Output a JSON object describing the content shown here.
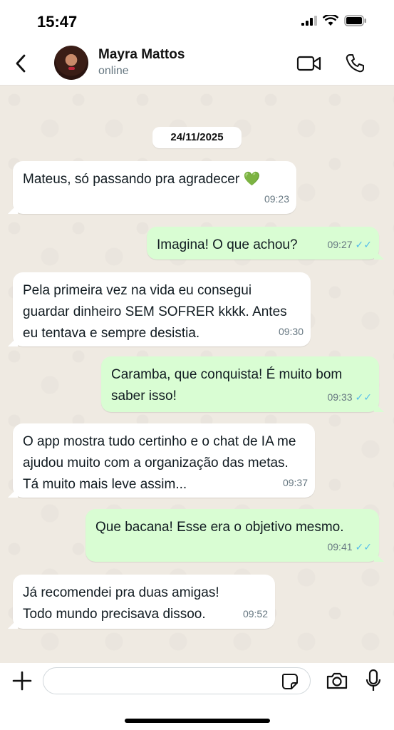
{
  "status_bar": {
    "time": "15:47"
  },
  "header": {
    "name": "Mayra Mattos",
    "status": "online"
  },
  "chat": {
    "date": "24/11/2025",
    "messages": [
      {
        "dir": "in",
        "text": "Mateus, só passando pra agradecer 💚",
        "time": "09:23"
      },
      {
        "dir": "out",
        "text": "Imagina! O que achou?",
        "time": "09:27",
        "ticks": "✓✓"
      },
      {
        "dir": "in",
        "text": "Pela primeira vez na vida eu consegui guardar dinheiro SEM SOFRER kkkk. Antes eu tentava e sempre desistia.",
        "time": "09:30"
      },
      {
        "dir": "out",
        "text": "Caramba, que conquista! É muito bom saber isso!",
        "time": "09:33",
        "ticks": "✓✓"
      },
      {
        "dir": "in",
        "text": "O app mostra tudo certinho e o chat de IA me ajudou muito com a organização das metas. Tá muito mais leve assim...",
        "time": "09:37"
      },
      {
        "dir": "out",
        "text": "Que bacana! Esse era o objetivo mesmo.",
        "time": "09:41",
        "ticks": "✓✓"
      },
      {
        "dir": "in",
        "text": "Já recomendei pra duas amigas! Todo mundo precisava dissoo.",
        "time": "09:52"
      }
    ]
  },
  "input": {
    "placeholder": "",
    "value": ""
  },
  "colors": {
    "incoming": "#ffffff",
    "outgoing": "#d9fdd3",
    "read_ticks": "#53bdeb",
    "background": "#efeae2"
  }
}
